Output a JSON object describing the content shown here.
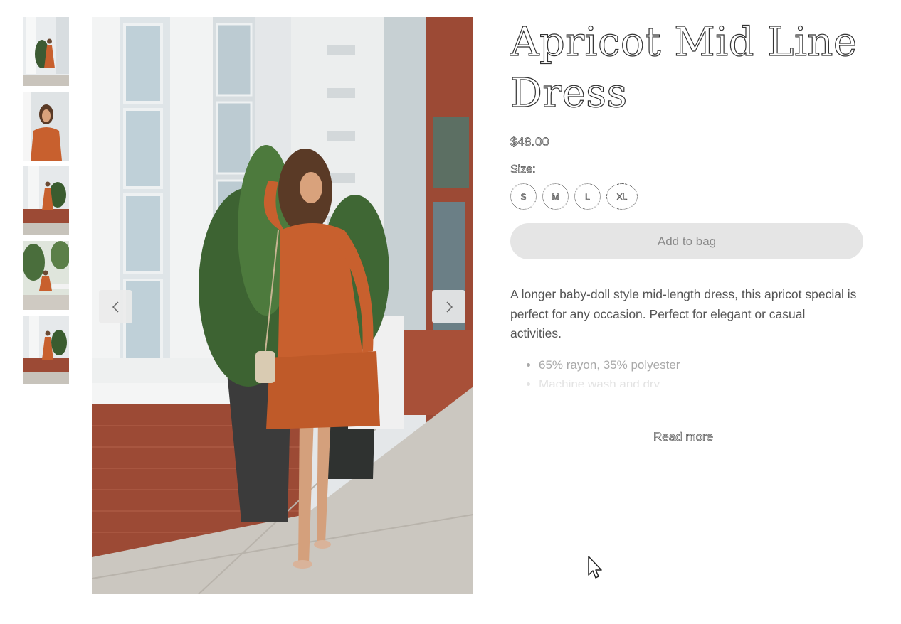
{
  "product": {
    "title": "Apricot Mid Line Dress",
    "price": "$48.00",
    "size_label": "Size:",
    "sizes": [
      "S",
      "M",
      "L",
      "XL"
    ],
    "add_to_bag": "Add to bag",
    "description": "A longer baby-doll style mid-length dress, this apricot special is perfect for any occasion. Perfect for elegant or casual activities.",
    "features": [
      "65% rayon, 35% polyester",
      "Machine wash and dry"
    ],
    "read_more": "Read more"
  },
  "gallery": {
    "thumbnail_count": 5,
    "prev_icon": "chevron-left-icon",
    "next_icon": "chevron-right-icon"
  },
  "colors": {
    "dress": "#c8602e",
    "brick": "#9c4a35",
    "button_bg": "#e5e5e5"
  }
}
